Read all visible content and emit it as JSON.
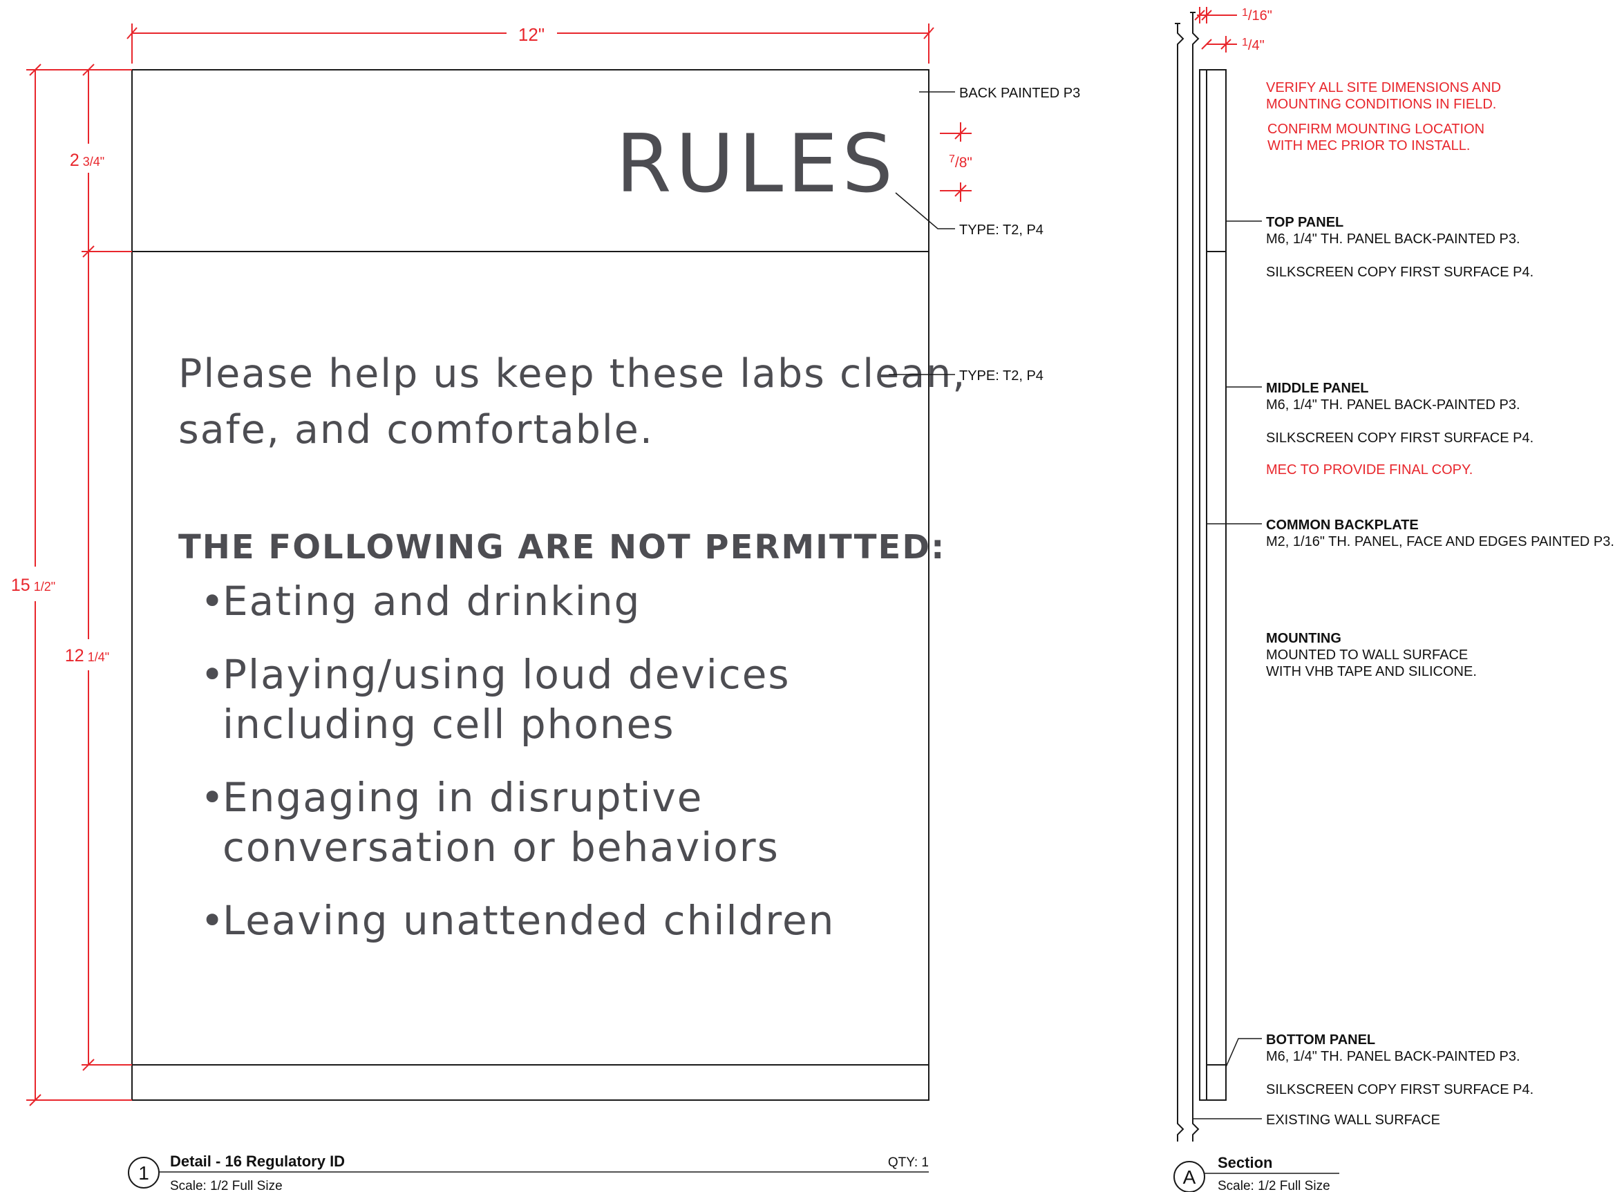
{
  "colors": {
    "dimension": "#e8262c",
    "line": "#1a1a1a",
    "sign_text": "#4d4d52",
    "note_red": "#e8262c"
  },
  "dimensions": {
    "width": "12\"",
    "overall_height_whole": "15",
    "overall_height_frac": "1/2\"",
    "top_panel_whole": "2",
    "top_panel_frac": "3/4\"",
    "middle_panel_whole": "12",
    "middle_panel_frac": "1/4\"",
    "letter_height_num": "7",
    "letter_height_den": "/8\"",
    "section_top_num": "1",
    "section_top_den": "/16\"",
    "section_second_num": "1",
    "section_second_den": "/4\""
  },
  "sign": {
    "header": "RULES",
    "intro_line1": "Please help us keep these labs clean,",
    "intro_line2": "safe, and comfortable.",
    "subheading": "THE FOLLOWING ARE NOT PERMITTED:",
    "bullet": "•",
    "rules": [
      {
        "line1": "Eating and drinking",
        "line2": ""
      },
      {
        "line1": "Playing/using loud devices",
        "line2": "including cell phones"
      },
      {
        "line1": "Engaging in disruptive",
        "line2": "conversation or behaviors"
      },
      {
        "line1": "Leaving unattended children",
        "line2": ""
      }
    ]
  },
  "callouts": {
    "back_painted": "BACK PAINTED P3",
    "type_header": "TYPE: T2, P4",
    "type_body": "TYPE: T2, P4"
  },
  "notes": {
    "verify_line1": "VERIFY ALL SITE DIMENSIONS AND",
    "verify_line2": "MOUNTING CONDITIONS IN FIELD.",
    "confirm_line1": "CONFIRM MOUNTING LOCATION",
    "confirm_line2": "WITH MEC PRIOR TO INSTALL.",
    "top_panel": {
      "title": "TOP PANEL",
      "line1": "M6, 1/4\" TH. PANEL BACK-PAINTED P3.",
      "line2": "SILKSCREEN COPY FIRST SURFACE P4."
    },
    "middle_panel": {
      "title": "MIDDLE PANEL",
      "line1": "M6, 1/4\" TH. PANEL BACK-PAINTED P3.",
      "line2": "SILKSCREEN COPY FIRST SURFACE P4.",
      "line3": "MEC TO PROVIDE FINAL COPY."
    },
    "backplate": {
      "title": "COMMON BACKPLATE",
      "line1": "M2, 1/16\" TH. PANEL, FACE AND EDGES PAINTED P3."
    },
    "mounting": {
      "title": "MOUNTING",
      "line1": "MOUNTED TO WALL SURFACE",
      "line2": "WITH VHB TAPE AND SILICONE."
    },
    "bottom_panel": {
      "title": "BOTTOM PANEL",
      "line1": "M6, 1/4\" TH. PANEL BACK-PAINTED P3.",
      "line2": "SILKSCREEN COPY FIRST SURFACE P4."
    },
    "wall": "EXISTING WALL SURFACE"
  },
  "titleblocks": {
    "detail": {
      "number": "1",
      "title": "Detail - 16 Regulatory ID",
      "scale": "Scale: 1/2 Full Size",
      "qty": "QTY: 1"
    },
    "section": {
      "letter": "A",
      "title": "Section",
      "scale": "Scale: 1/2 Full Size"
    }
  }
}
